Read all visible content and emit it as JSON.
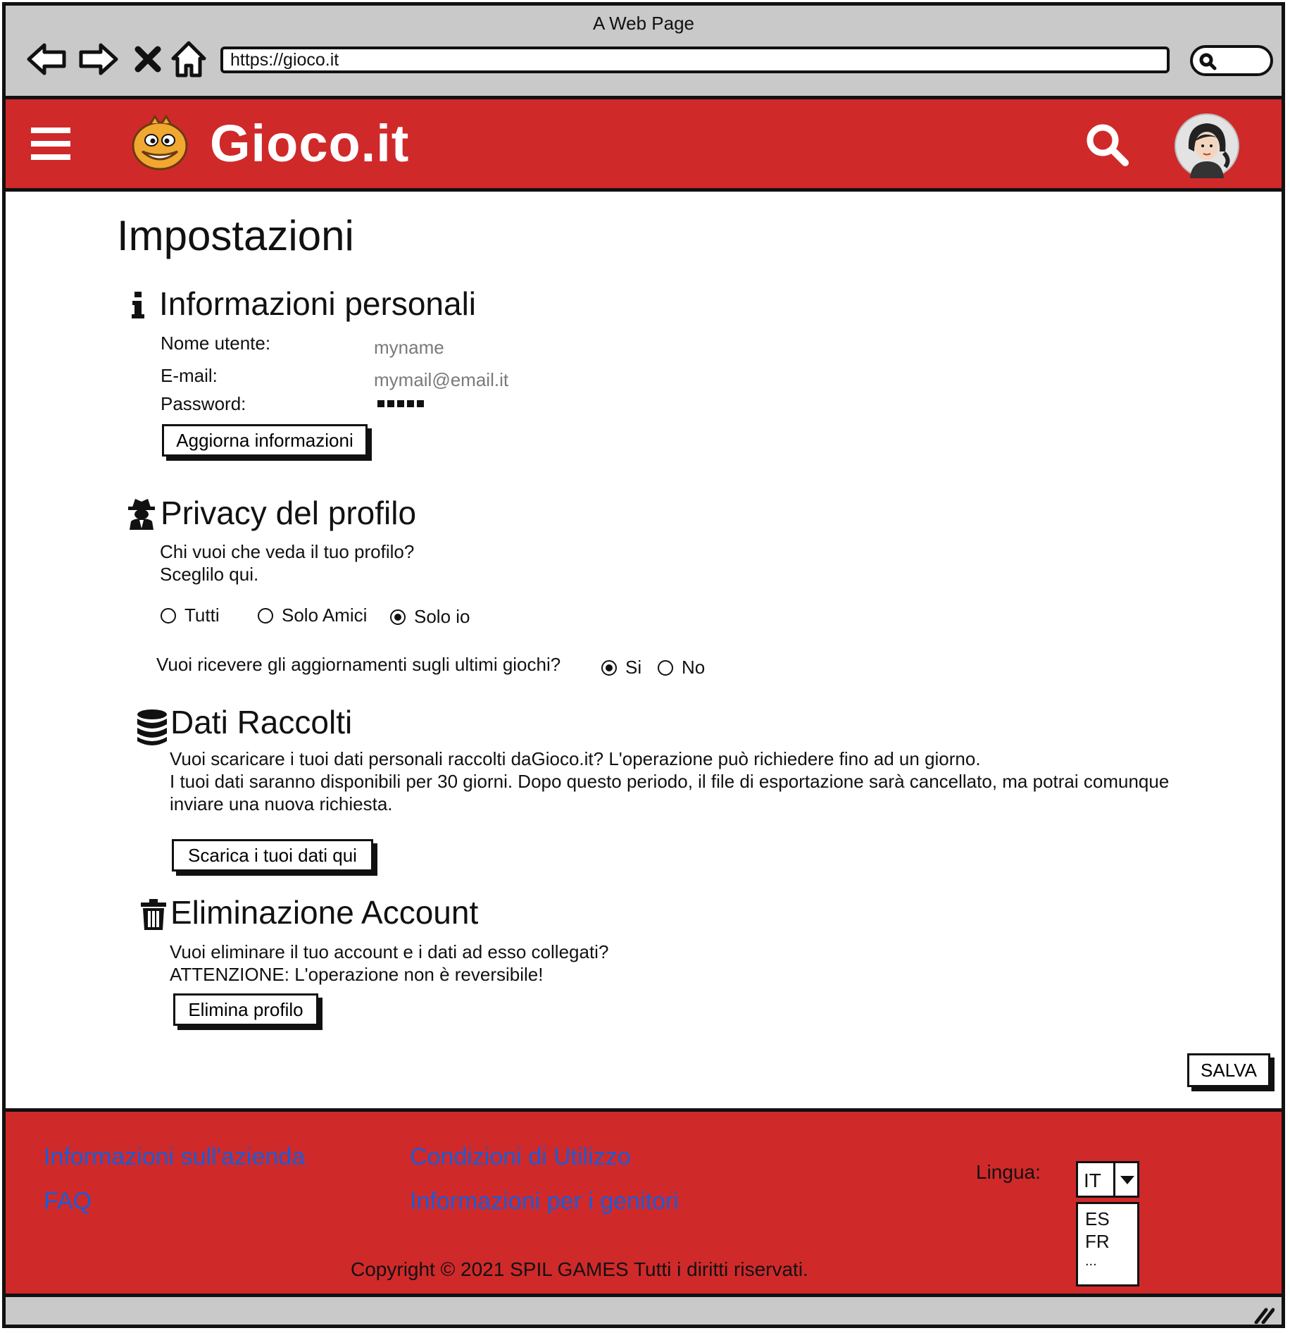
{
  "browser": {
    "window_title": "A Web Page",
    "url": "https://gioco.it"
  },
  "header": {
    "logo_text": "Gioco.it"
  },
  "page": {
    "title": "Impostazioni"
  },
  "personal_info": {
    "heading": "Informazioni personali",
    "username_label": "Nome utente:",
    "username_value": "myname",
    "email_label": "E-mail:",
    "email_value": "mymail@email.it",
    "password_label": "Password:",
    "update_button": "Aggiorna informazioni"
  },
  "privacy": {
    "heading": "Privacy del profilo",
    "question_line1": "Chi vuoi che veda il tuo profilo?",
    "question_line2": "Sceglilo qui.",
    "options": [
      "Tutti",
      "Solo Amici",
      "Solo io"
    ],
    "selected": "Solo io",
    "updates_question": "Vuoi ricevere gli aggiornamenti sugli ultimi giochi?",
    "updates_options": [
      "Si",
      "No"
    ],
    "updates_selected": "Si"
  },
  "data_collected": {
    "heading": "Dati Raccolti",
    "line1": "Vuoi scaricare i tuoi dati personali raccolti daGioco.it?  L'operazione può richiedere fino ad un giorno.",
    "line2": "I tuoi dati saranno disponibili per 30 giorni. Dopo questo periodo, il file di esportazione sarà cancellato, ma potrai comunque",
    "line3": "inviare una nuova richiesta.",
    "download_button": "Scarica i tuoi dati qui"
  },
  "delete_account": {
    "heading": "Eliminazione Account",
    "line1": "Vuoi eliminare il tuo account e i dati ad esso collegati?",
    "line2": "ATTENZIONE: L'operazione non è reversibile!",
    "delete_button": "Elimina profilo"
  },
  "save_button": "SALVA",
  "footer": {
    "link_company": "Informazioni sull'azienda",
    "link_faq": "FAQ",
    "link_terms": "Condizioni di Utilizzo",
    "link_parents": "Informazioni per i genitori",
    "language_label": "Lingua:",
    "language_selected": "IT",
    "language_options": [
      "ES",
      "FR",
      "..."
    ],
    "copyright": "Copyright © 2021 SPIL GAMES Tutti i diritti riservati."
  },
  "colors": {
    "brand_red": "#d0292a",
    "link_blue": "#1b5cd6",
    "chrome_gray": "#c9c9c9"
  },
  "icons": [
    "back-arrow-icon",
    "forward-arrow-icon",
    "close-icon",
    "home-icon",
    "search-icon",
    "menu-icon",
    "mascot-logo-icon",
    "avatar",
    "info-icon",
    "spy-icon",
    "database-icon",
    "trash-icon",
    "dropdown-arrow-icon",
    "resize-grip-icon"
  ]
}
